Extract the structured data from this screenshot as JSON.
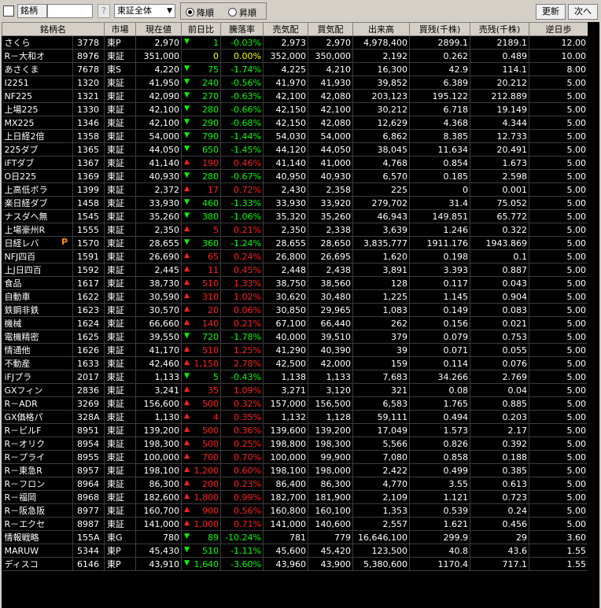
{
  "toolbar": {
    "code_label": "銘柄",
    "help_label": "?",
    "market_select": "東証全体",
    "order_desc": "降順",
    "order_asc": "昇順",
    "refresh_label": "更新",
    "next_label": "次へ"
  },
  "columns": [
    "銘柄名",
    "",
    "市場",
    "現在値",
    "前日比",
    "騰落率",
    "売気配",
    "買気配",
    "出来高",
    "買残(千株)",
    "売残(千株)",
    "逆日歩"
  ],
  "rows": [
    {
      "name": "さくら",
      "code": "3778",
      "mkt": "東P",
      "price": "2,970",
      "dir": "down",
      "chg": "1",
      "pct": "-0.03%",
      "ask": "2,973",
      "bid": "2,970",
      "vol": "4,978,400",
      "buy": "2899.1",
      "sell": "2189.1",
      "rev": "12.00"
    },
    {
      "name": "R－大和オ",
      "code": "8976",
      "mkt": "東証",
      "price": "351,000",
      "dir": "flat",
      "chg": "0",
      "pct": "0.00%",
      "ask": "352,000",
      "bid": "350,000",
      "vol": "2,192",
      "buy": "0.262",
      "sell": "0.489",
      "rev": "10.00"
    },
    {
      "name": "あさくま",
      "code": "7678",
      "mkt": "東S",
      "price": "4,220",
      "dir": "down",
      "chg": "75",
      "pct": "-1.74%",
      "ask": "4,225",
      "bid": "4,210",
      "vol": "16,300",
      "buy": "42.9",
      "sell": "114.1",
      "rev": "8.00"
    },
    {
      "name": "I2251",
      "code": "1320",
      "mkt": "東証",
      "price": "41,950",
      "dir": "down",
      "chg": "240",
      "pct": "-0.56%",
      "ask": "41,970",
      "bid": "41,930",
      "vol": "39,852",
      "buy": "6.389",
      "sell": "20.212",
      "rev": "5.00"
    },
    {
      "name": "NF225",
      "code": "1321",
      "mkt": "東証",
      "price": "42,090",
      "dir": "down",
      "chg": "270",
      "pct": "-0.63%",
      "ask": "42,100",
      "bid": "42,080",
      "vol": "203,123",
      "buy": "195.122",
      "sell": "212.889",
      "rev": "5.00"
    },
    {
      "name": "上場225",
      "code": "1330",
      "mkt": "東証",
      "price": "42,100",
      "dir": "down",
      "chg": "280",
      "pct": "-0.66%",
      "ask": "42,150",
      "bid": "42,100",
      "vol": "30,212",
      "buy": "6.718",
      "sell": "19.149",
      "rev": "5.00"
    },
    {
      "name": "MX225",
      "code": "1346",
      "mkt": "東証",
      "price": "42,100",
      "dir": "down",
      "chg": "290",
      "pct": "-0.68%",
      "ask": "42,150",
      "bid": "42,080",
      "vol": "12,629",
      "buy": "4.368",
      "sell": "4.344",
      "rev": "5.00"
    },
    {
      "name": "上日経2倍",
      "code": "1358",
      "mkt": "東証",
      "price": "54,000",
      "dir": "down",
      "chg": "790",
      "pct": "-1.44%",
      "ask": "54,030",
      "bid": "54,000",
      "vol": "6,862",
      "buy": "8.385",
      "sell": "12.733",
      "rev": "5.00"
    },
    {
      "name": "225ダブ",
      "code": "1365",
      "mkt": "東証",
      "price": "44,050",
      "dir": "down",
      "chg": "650",
      "pct": "-1.45%",
      "ask": "44,120",
      "bid": "44,050",
      "vol": "38,045",
      "buy": "11.634",
      "sell": "20.491",
      "rev": "5.00"
    },
    {
      "name": "iFTダブ",
      "code": "1367",
      "mkt": "東証",
      "price": "41,140",
      "dir": "up",
      "chg": "190",
      "pct": "0.46%",
      "ask": "41,140",
      "bid": "41,000",
      "vol": "4,768",
      "buy": "0.854",
      "sell": "1.673",
      "rev": "5.00"
    },
    {
      "name": "O日225",
      "code": "1369",
      "mkt": "東証",
      "price": "40,930",
      "dir": "down",
      "chg": "280",
      "pct": "-0.67%",
      "ask": "40,950",
      "bid": "40,930",
      "vol": "6,570",
      "buy": "0.185",
      "sell": "2.598",
      "rev": "5.00"
    },
    {
      "name": "上高低ボラ",
      "code": "1399",
      "mkt": "東証",
      "price": "2,372",
      "dir": "up",
      "chg": "17",
      "pct": "0.72%",
      "ask": "2,430",
      "bid": "2,358",
      "vol": "225",
      "buy": "0",
      "sell": "0.001",
      "rev": "5.00"
    },
    {
      "name": "楽日経ダブ",
      "code": "1458",
      "mkt": "東証",
      "price": "33,930",
      "dir": "down",
      "chg": "460",
      "pct": "-1.33%",
      "ask": "33,930",
      "bid": "33,920",
      "vol": "279,702",
      "buy": "31.4",
      "sell": "75.052",
      "rev": "5.00"
    },
    {
      "name": "ナスダヘ無",
      "code": "1545",
      "mkt": "東証",
      "price": "35,260",
      "dir": "down",
      "chg": "380",
      "pct": "-1.06%",
      "ask": "35,320",
      "bid": "35,260",
      "vol": "46,943",
      "buy": "149.851",
      "sell": "65.772",
      "rev": "5.00"
    },
    {
      "name": "上場豪州R",
      "code": "1555",
      "mkt": "東証",
      "price": "2,350",
      "dir": "up",
      "chg": "5",
      "pct": "0.21%",
      "ask": "2,350",
      "bid": "2,338",
      "vol": "3,639",
      "buy": "1.246",
      "sell": "0.322",
      "rev": "5.00"
    },
    {
      "name": "日経レバ",
      "code": "1570",
      "mkt": "東証",
      "price": "28,655",
      "dir": "down",
      "chg": "360",
      "pct": "-1.24%",
      "ask": "28,655",
      "bid": "28,650",
      "vol": "3,835,777",
      "buy": "1911.176",
      "sell": "1943.869",
      "rev": "5.00",
      "pmark": "P"
    },
    {
      "name": "NFJ四百",
      "code": "1591",
      "mkt": "東証",
      "price": "26,690",
      "dir": "up",
      "chg": "65",
      "pct": "0.24%",
      "ask": "26,800",
      "bid": "26,695",
      "vol": "1,620",
      "buy": "0.198",
      "sell": "0.1",
      "rev": "5.00"
    },
    {
      "name": "上J日四百",
      "code": "1592",
      "mkt": "東証",
      "price": "2,445",
      "dir": "up",
      "chg": "11",
      "pct": "0.45%",
      "ask": "2,448",
      "bid": "2,438",
      "vol": "3,891",
      "buy": "3.393",
      "sell": "0.887",
      "rev": "5.00"
    },
    {
      "name": "食品",
      "code": "1617",
      "mkt": "東証",
      "price": "38,730",
      "dir": "up",
      "chg": "510",
      "pct": "1.33%",
      "ask": "38,750",
      "bid": "38,560",
      "vol": "128",
      "buy": "0.117",
      "sell": "0.043",
      "rev": "5.00"
    },
    {
      "name": "自動車",
      "code": "1622",
      "mkt": "東証",
      "price": "30,590",
      "dir": "up",
      "chg": "310",
      "pct": "1.02%",
      "ask": "30,620",
      "bid": "30,480",
      "vol": "1,225",
      "buy": "1.145",
      "sell": "0.904",
      "rev": "5.00"
    },
    {
      "name": "鉄鋼非鉄",
      "code": "1623",
      "mkt": "東証",
      "price": "30,570",
      "dir": "up",
      "chg": "20",
      "pct": "0.06%",
      "ask": "30,850",
      "bid": "29,965",
      "vol": "1,083",
      "buy": "0.149",
      "sell": "0.083",
      "rev": "5.00"
    },
    {
      "name": "機械",
      "code": "1624",
      "mkt": "東証",
      "price": "66,660",
      "dir": "up",
      "chg": "140",
      "pct": "0.21%",
      "ask": "67,100",
      "bid": "66,440",
      "vol": "262",
      "buy": "0.156",
      "sell": "0.021",
      "rev": "5.00"
    },
    {
      "name": "電機精密",
      "code": "1625",
      "mkt": "東証",
      "price": "39,550",
      "dir": "down",
      "chg": "720",
      "pct": "-1.78%",
      "ask": "40,000",
      "bid": "39,510",
      "vol": "379",
      "buy": "0.079",
      "sell": "0.753",
      "rev": "5.00"
    },
    {
      "name": "情通他",
      "code": "1626",
      "mkt": "東証",
      "price": "41,170",
      "dir": "up",
      "chg": "510",
      "pct": "1.25%",
      "ask": "41,290",
      "bid": "40,390",
      "vol": "39",
      "buy": "0.071",
      "sell": "0.055",
      "rev": "5.00"
    },
    {
      "name": "不動産",
      "code": "1633",
      "mkt": "東証",
      "price": "42,460",
      "dir": "up",
      "chg": "1,150",
      "pct": "2.78%",
      "ask": "42,500",
      "bid": "42,000",
      "vol": "159",
      "buy": "0.114",
      "sell": "0.076",
      "rev": "5.00"
    },
    {
      "name": "iFJプラ",
      "code": "2017",
      "mkt": "東証",
      "price": "1,133",
      "dir": "down",
      "chg": "5",
      "pct": "-0.43%",
      "ask": "1,138",
      "bid": "1,133",
      "vol": "7,683",
      "buy": "34.266",
      "sell": "2.769",
      "rev": "5.00"
    },
    {
      "name": "GXフィン",
      "code": "2836",
      "mkt": "東証",
      "price": "3,241",
      "dir": "up",
      "chg": "35",
      "pct": "1.09%",
      "ask": "3,271",
      "bid": "3,120",
      "vol": "321",
      "buy": "0.08",
      "sell": "0.04",
      "rev": "5.00"
    },
    {
      "name": "R－ADR",
      "code": "3269",
      "mkt": "東証",
      "price": "156,600",
      "dir": "up",
      "chg": "500",
      "pct": "0.32%",
      "ask": "157,000",
      "bid": "156,500",
      "vol": "6,583",
      "buy": "1.765",
      "sell": "0.885",
      "rev": "5.00"
    },
    {
      "name": "GX価格パ",
      "code": "328A",
      "mkt": "東証",
      "price": "1,130",
      "dir": "up",
      "chg": "4",
      "pct": "0.35%",
      "ask": "1,132",
      "bid": "1,128",
      "vol": "59,111",
      "buy": "0.494",
      "sell": "0.203",
      "rev": "5.00"
    },
    {
      "name": "R－ビルF",
      "code": "8951",
      "mkt": "東証",
      "price": "139,200",
      "dir": "up",
      "chg": "500",
      "pct": "0.36%",
      "ask": "139,600",
      "bid": "139,200",
      "vol": "17,049",
      "buy": "1.573",
      "sell": "2.17",
      "rev": "5.00"
    },
    {
      "name": "R－オリク",
      "code": "8954",
      "mkt": "東証",
      "price": "198,300",
      "dir": "up",
      "chg": "500",
      "pct": "0.25%",
      "ask": "198,800",
      "bid": "198,300",
      "vol": "5,566",
      "buy": "0.826",
      "sell": "0.392",
      "rev": "5.00"
    },
    {
      "name": "R－プライ",
      "code": "8955",
      "mkt": "東証",
      "price": "100,000",
      "dir": "up",
      "chg": "700",
      "pct": "0.70%",
      "ask": "100,000",
      "bid": "99,900",
      "vol": "7,080",
      "buy": "0.858",
      "sell": "0.188",
      "rev": "5.00"
    },
    {
      "name": "R－東急R",
      "code": "8957",
      "mkt": "東証",
      "price": "198,100",
      "dir": "up",
      "chg": "1,200",
      "pct": "0.60%",
      "ask": "198,100",
      "bid": "198,000",
      "vol": "2,422",
      "buy": "0.499",
      "sell": "0.385",
      "rev": "5.00"
    },
    {
      "name": "R－フロン",
      "code": "8964",
      "mkt": "東証",
      "price": "86,300",
      "dir": "up",
      "chg": "200",
      "pct": "0.23%",
      "ask": "86,400",
      "bid": "86,300",
      "vol": "4,770",
      "buy": "3.55",
      "sell": "0.613",
      "rev": "5.00"
    },
    {
      "name": "R－福岡",
      "code": "8968",
      "mkt": "東証",
      "price": "182,600",
      "dir": "up",
      "chg": "1,800",
      "pct": "0.99%",
      "ask": "182,700",
      "bid": "181,900",
      "vol": "2,109",
      "buy": "1.121",
      "sell": "0.723",
      "rev": "5.00"
    },
    {
      "name": "R－阪急阪",
      "code": "8977",
      "mkt": "東証",
      "price": "160,700",
      "dir": "up",
      "chg": "900",
      "pct": "0.56%",
      "ask": "160,800",
      "bid": "160,100",
      "vol": "1,353",
      "buy": "0.539",
      "sell": "0.24",
      "rev": "5.00"
    },
    {
      "name": "R－エクセ",
      "code": "8987",
      "mkt": "東証",
      "price": "141,000",
      "dir": "up",
      "chg": "1,000",
      "pct": "0.71%",
      "ask": "141,000",
      "bid": "140,600",
      "vol": "2,557",
      "buy": "1.621",
      "sell": "0.456",
      "rev": "5.00"
    },
    {
      "name": "情報戦略",
      "code": "155A",
      "mkt": "東G",
      "price": "780",
      "dir": "down",
      "chg": "89",
      "pct": "-10.24%",
      "ask": "781",
      "bid": "779",
      "vol": "16,646,100",
      "buy": "299.9",
      "sell": "29",
      "rev": "3.60"
    },
    {
      "name": "MARUW",
      "code": "5344",
      "mkt": "東P",
      "price": "45,430",
      "dir": "down",
      "chg": "510",
      "pct": "-1.11%",
      "ask": "45,600",
      "bid": "45,420",
      "vol": "123,500",
      "buy": "40.8",
      "sell": "43.6",
      "rev": "1.55"
    },
    {
      "name": "ディスコ",
      "code": "6146",
      "mkt": "東P",
      "price": "43,910",
      "dir": "down",
      "chg": "1,640",
      "pct": "-3.60%",
      "ask": "43,960",
      "bid": "43,900",
      "vol": "5,380,600",
      "buy": "1170.4",
      "sell": "717.1",
      "rev": "1.55"
    }
  ],
  "colors": {
    "up": "#ff2020",
    "down": "#00ff00",
    "flat": "#ffff00",
    "bg": "#000000",
    "mark": "#ff8c00"
  }
}
